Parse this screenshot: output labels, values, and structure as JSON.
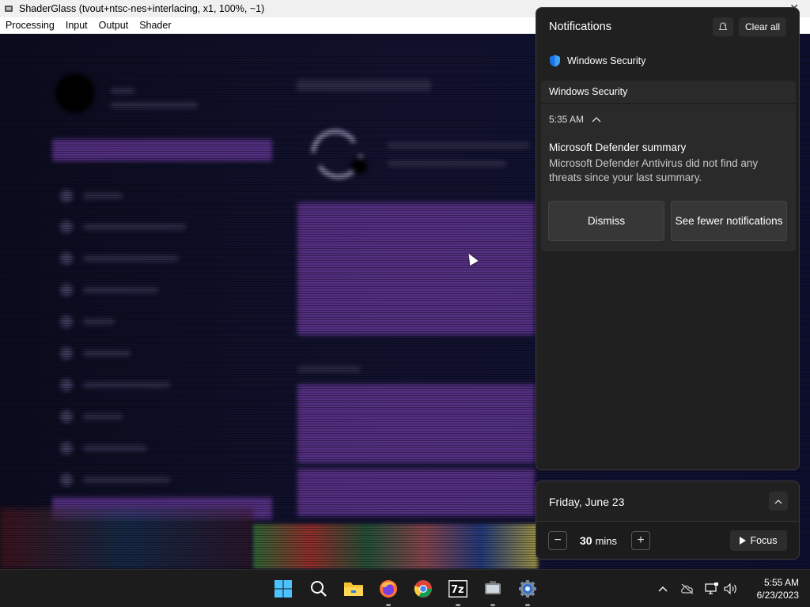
{
  "window": {
    "title": "ShaderGlass (tvout+ntsc-nes+interlacing, x1, 100%, ~1)",
    "menu": [
      "Processing",
      "Input",
      "Output",
      "Shader"
    ]
  },
  "notifications": {
    "header": "Notifications",
    "clear_all_label": "Clear all",
    "app_name": "Windows Security",
    "group_header": "Windows Security",
    "card": {
      "time": "5:35 AM",
      "title": "Microsoft Defender summary",
      "body": "Microsoft Defender Antivirus did not find any threats since your last summary.",
      "dismiss_label": "Dismiss",
      "fewer_label": "See fewer notifications"
    }
  },
  "calendar": {
    "date": "Friday, June 23",
    "focus_minutes": "30",
    "focus_unit": "mins",
    "focus_label": "Focus"
  },
  "taskbar": {
    "items": [
      "windows-start",
      "search",
      "file-explorer",
      "firefox",
      "chrome",
      "7zip",
      "shaderglass",
      "settings"
    ],
    "clock_time": "5:55 AM",
    "clock_date": "6/23/2023"
  },
  "colors": {
    "panel_bg": "#202020",
    "accent_shield": "#1a73e8",
    "crt_purple": "#6a3a9e"
  }
}
